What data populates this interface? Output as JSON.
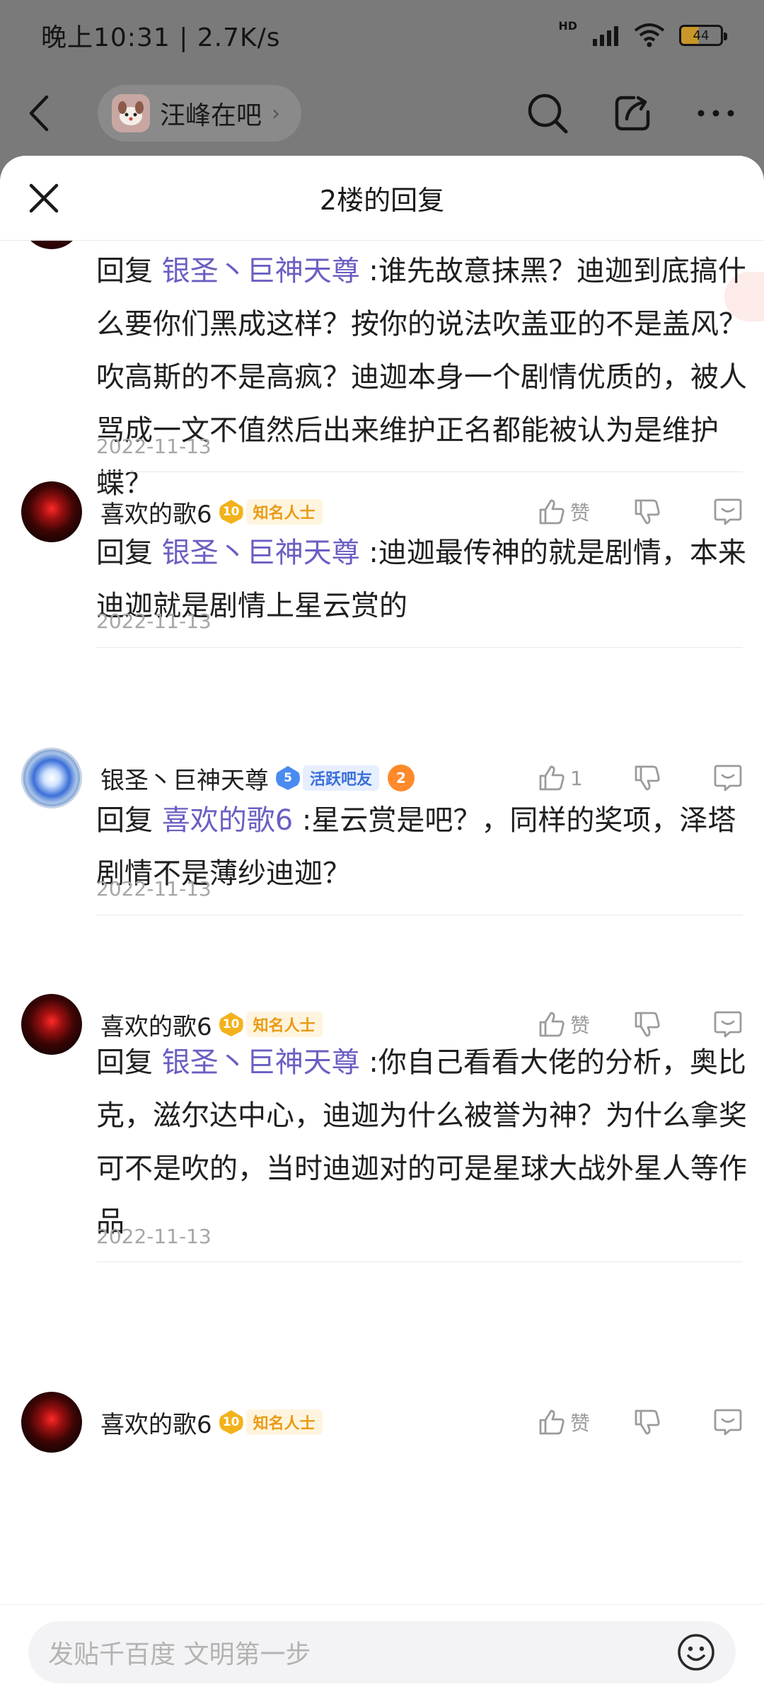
{
  "status_bar": {
    "time": "晚上10:31 | 2.7K/s",
    "hd": "HD",
    "battery": "44"
  },
  "nav": {
    "forum_name": "汪峰在吧",
    "chevron": "›"
  },
  "sheet": {
    "title": "2楼的回复"
  },
  "replies": [
    {
      "prefix": "回复 ",
      "mention": "银圣丶巨神天尊",
      "text": " :谁先故意抹黑？迪迦到底搞什么要你们黑成这样？按你的说法吹盖亚的不是盖风？吹高斯的不是高疯？迪迦本身一个剧情优质的，被人骂成一文不值然后出来维护正名都能被认为是维护蝶？",
      "date": "2022-11-13"
    },
    {
      "username": "喜欢的歌6",
      "level": "10",
      "tag": "知名人士",
      "like_label": "赞",
      "prefix": "回复 ",
      "mention": "银圣丶巨神天尊",
      "text": " :迪迦最传神的就是剧情，本来迪迦就是剧情上星云赏的",
      "date": "2022-11-13"
    },
    {
      "username": "银圣丶巨神天尊",
      "level": "5",
      "tag": "活跃吧友",
      "fire": "2",
      "like_label": "1",
      "prefix": "回复 ",
      "mention": "喜欢的歌6",
      "text": " :星云赏是吧？，同样的奖项，泽塔剧情不是薄纱迪迦？",
      "date": "2022-11-13"
    },
    {
      "username": "喜欢的歌6",
      "level": "10",
      "tag": "知名人士",
      "like_label": "赞",
      "prefix": "回复 ",
      "mention": "银圣丶巨神天尊",
      "text": " :你自己看看大佬的分析，奥比克，滋尔达中心，迪迦为什么被誉为神？为什么拿奖可不是吹的，当时迪迦对的可是星球大战外星人等作品",
      "date": "2022-11-13"
    },
    {
      "username": "喜欢的歌6",
      "level": "10",
      "tag": "知名人士",
      "like_label": "赞"
    }
  ],
  "input": {
    "placeholder": "发贴千百度 文明第一步"
  }
}
